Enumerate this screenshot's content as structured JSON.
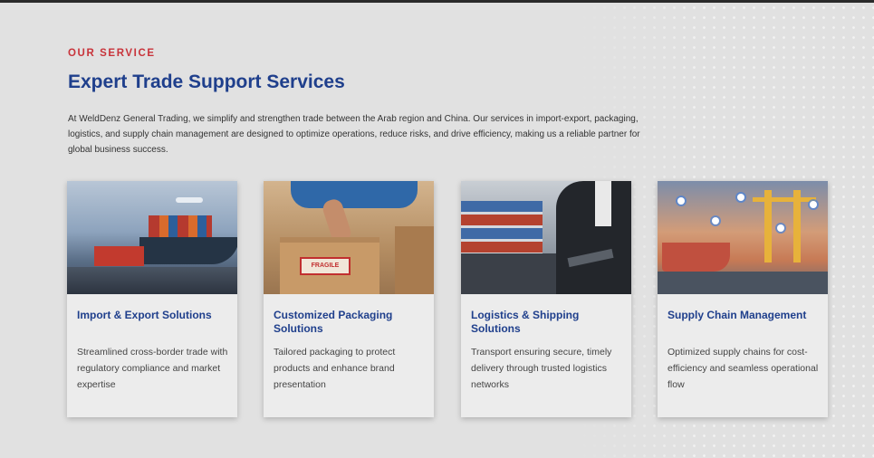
{
  "section": {
    "eyebrow": "OUR SERVICE",
    "title": "Expert Trade Support Services",
    "description": "At WeldDenz General Trading, we simplify and strengthen trade between the Arab region and China. Our services in import-export, packaging, logistics, and supply chain management are designed to optimize operations, reduce risks, and drive efficiency, making us a reliable partner for global business success."
  },
  "colors": {
    "accent_red": "#c8333a",
    "heading_blue": "#1f3f8c",
    "background": "#e1e1e1",
    "card_background": "#ececec"
  },
  "cards": [
    {
      "title": "Import & Export Solutions",
      "text": "Streamlined cross-border trade with regulatory compliance and market expertise",
      "image": "ships-and-trucks-photo"
    },
    {
      "title": "Customized Packaging Solutions",
      "text": "Tailored packaging to protect products and enhance brand presentation",
      "image": "packaging-box-fragile-photo",
      "image_label": "FRAGILE"
    },
    {
      "title": "Logistics & Shipping Solutions",
      "text": "Transport ensuring secure, timely delivery through trusted logistics networks",
      "image": "port-businessman-tablet-photo"
    },
    {
      "title": "Supply Chain Management",
      "text": "Optimized supply chains for cost-efficiency and seamless operational flow",
      "image": "port-cranes-network-photo"
    }
  ]
}
